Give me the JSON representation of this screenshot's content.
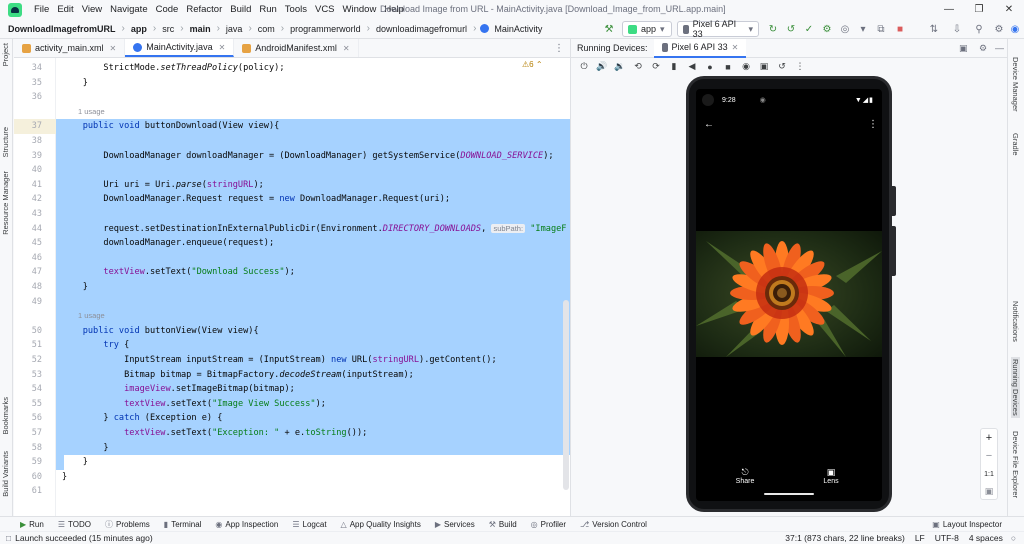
{
  "menu": [
    "File",
    "Edit",
    "View",
    "Navigate",
    "Code",
    "Refactor",
    "Build",
    "Run",
    "Tools",
    "VCS",
    "Window",
    "Help"
  ],
  "window_title": "Download Image from URL - MainActivity.java [Download_Image_from_URL.app.main]",
  "breadcrumb": [
    "DownloadImagefromURL",
    "app",
    "src",
    "main",
    "java",
    "com",
    "programmerworld",
    "downloadimagefromurl",
    "MainActivity"
  ],
  "run_config": "app",
  "device_select": "Pixel 6 API 33",
  "editor_tabs": [
    "activity_main.xml",
    "MainActivity.java",
    "AndroidManifest.xml"
  ],
  "warning_count": "6",
  "left_tools": [
    "Project",
    "Structure",
    "Resource Manager",
    "Bookmarks",
    "Build Variants"
  ],
  "right_tools": [
    "Device Manager",
    "Gradle",
    "Notifications",
    "Running Devices",
    "Device File Explorer"
  ],
  "code_lines": [
    {
      "n": "34",
      "sel": false,
      "html": "        StrictMode.<span class='it'>setThreadPolicy</span>(policy);"
    },
    {
      "n": "35",
      "sel": false,
      "html": "    }"
    },
    {
      "n": "36",
      "sel": false,
      "html": ""
    },
    {
      "n": "",
      "usage": "1 usage"
    },
    {
      "n": "37",
      "sel": true,
      "html": "    <span class='kw'>public void</span> buttonDownload(View view){"
    },
    {
      "n": "38",
      "sel": true,
      "html": ""
    },
    {
      "n": "39",
      "sel": true,
      "html": "        DownloadManager downloadManager = (DownloadManager) getSystemService(<span class='cst'>DOWNLOAD_SERVICE</span>);"
    },
    {
      "n": "40",
      "sel": true,
      "html": ""
    },
    {
      "n": "41",
      "sel": true,
      "html": "        Uri uri = Uri.<span class='it'>parse</span>(<span class='fld'>stringURL</span>);"
    },
    {
      "n": "42",
      "sel": true,
      "html": "        DownloadManager.Request request = <span class='kw'>new</span> DownloadManager.Request(uri);"
    },
    {
      "n": "43",
      "sel": true,
      "html": ""
    },
    {
      "n": "44",
      "sel": true,
      "html": "        request.setDestinationInExternalPublicDir(Environment.<span class='cst'>DIRECTORY_DOWNLOADS</span>, <span class='hint'>subPath:</span> <span class='str'>\"ImageF</span>"
    },
    {
      "n": "45",
      "sel": true,
      "html": "        downloadManager.enqueue(request);"
    },
    {
      "n": "46",
      "sel": true,
      "html": ""
    },
    {
      "n": "47",
      "sel": true,
      "html": "        <span class='fld'>textView</span>.setText(<span class='str'>\"Download Success\"</span>);"
    },
    {
      "n": "48",
      "sel": true,
      "html": "    }"
    },
    {
      "n": "49",
      "sel": true,
      "html": ""
    },
    {
      "n": "",
      "usage": "1 usage",
      "sel": true
    },
    {
      "n": "50",
      "sel": true,
      "html": "    <span class='kw'>public void</span> buttonView(View view){"
    },
    {
      "n": "51",
      "sel": true,
      "html": "        <span class='kw'>try</span> {"
    },
    {
      "n": "52",
      "sel": true,
      "html": "            InputStream inputStream = (InputStream) <span class='kw'>new</span> URL(<span class='fld'>stringURL</span>).getContent();"
    },
    {
      "n": "53",
      "sel": true,
      "html": "            Bitmap bitmap = BitmapFactory.<span class='it'>decodeStream</span>(inputStream);"
    },
    {
      "n": "54",
      "sel": true,
      "html": "            <span class='fld'>imageView</span>.setImageBitmap(bitmap);"
    },
    {
      "n": "55",
      "sel": true,
      "html": "            <span class='fld'>textView</span>.setText(<span class='str'>\"Image View Success\"</span>);"
    },
    {
      "n": "56",
      "sel": true,
      "html": "        } <span class='kw'>catch</span> (Exception e) {"
    },
    {
      "n": "57",
      "sel": true,
      "html": "            <span class='fld'>textView</span>.setText(<span class='str'>\"Exception: \"</span> + e.<span class='str'>toString</span>());"
    },
    {
      "n": "58",
      "sel": true,
      "html": "        }"
    },
    {
      "n": "59",
      "sel": "partial",
      "html": "    }"
    },
    {
      "n": "60",
      "sel": false,
      "html": "}"
    },
    {
      "n": "61",
      "sel": false,
      "html": ""
    }
  ],
  "running_devices": {
    "label": "Running Devices:",
    "tab": "Pixel 6 API 33"
  },
  "phone": {
    "time": "9:28",
    "share_label": "Share",
    "lens_label": "Lens"
  },
  "zoom": {
    "plus": "+",
    "minus": "−",
    "ratio": "1:1"
  },
  "bottom_tools": [
    "Run",
    "TODO",
    "Problems",
    "Terminal",
    "App Inspection",
    "Logcat",
    "App Quality Insights",
    "Services",
    "Build",
    "Profiler",
    "Version Control"
  ],
  "layout_inspector": "Layout Inspector",
  "status": {
    "message": "Launch succeeded (15 minutes ago)",
    "position": "37:1 (873 chars, 22 line breaks)",
    "line_sep": "LF",
    "encoding": "UTF-8",
    "indent": "4 spaces"
  },
  "colors": {
    "selection": "#a6d2ff",
    "accent": "#3574f0",
    "keyword": "#0033b3",
    "string": "#067d17",
    "field": "#871094"
  }
}
